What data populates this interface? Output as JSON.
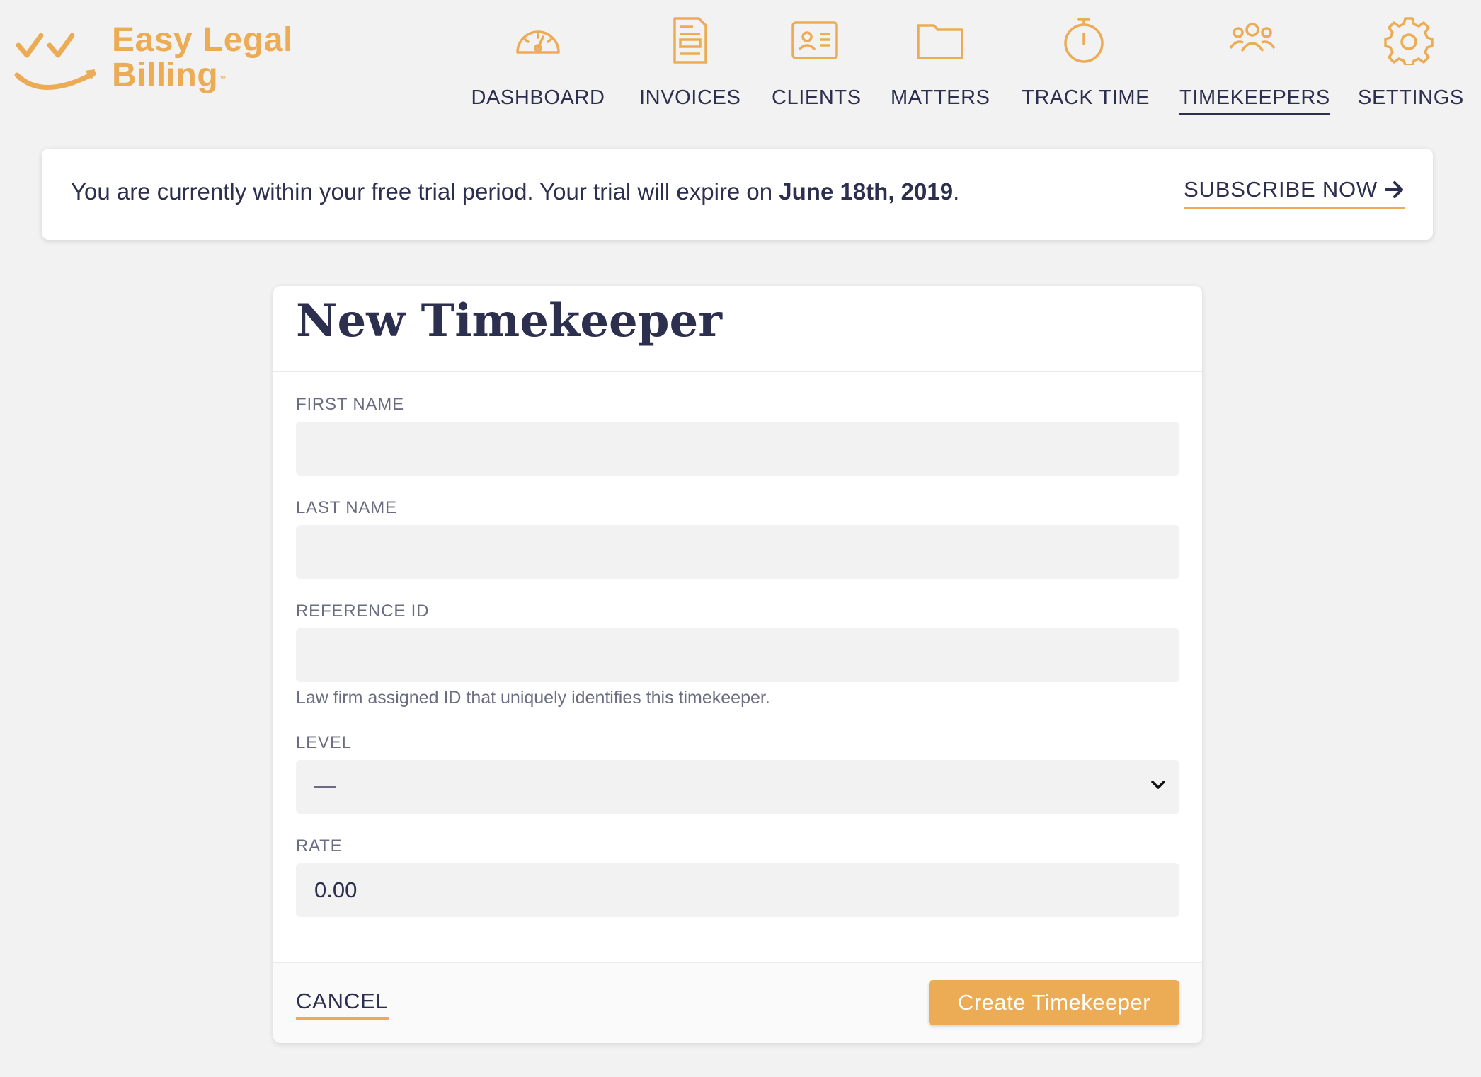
{
  "brand": {
    "line1": "Easy Legal",
    "line2": "Billing",
    "trademark": "™",
    "color": "#ecac55"
  },
  "nav": {
    "items": [
      {
        "label": "DASHBOARD",
        "icon": "gauge-icon"
      },
      {
        "label": "INVOICES",
        "icon": "document-icon"
      },
      {
        "label": "CLIENTS",
        "icon": "contact-card-icon"
      },
      {
        "label": "MATTERS",
        "icon": "folder-icon"
      },
      {
        "label": "TRACK TIME",
        "icon": "stopwatch-icon"
      },
      {
        "label": "TIMEKEEPERS",
        "icon": "people-icon",
        "active": true
      },
      {
        "label": "SETTINGS",
        "icon": "gear-icon"
      }
    ]
  },
  "banner": {
    "text": "You are currently within your free trial period. Your trial will expire on ",
    "date": "June 18th, 2019",
    "suffix": ".",
    "subscribe_label": "SUBSCRIBE NOW"
  },
  "form": {
    "title": "New Timekeeper",
    "first_name": {
      "label": "FIRST NAME",
      "value": ""
    },
    "last_name": {
      "label": "LAST NAME",
      "value": ""
    },
    "reference_id": {
      "label": "REFERENCE ID",
      "value": "",
      "help": "Law firm assigned ID that uniquely identifies this timekeeper."
    },
    "level": {
      "label": "LEVEL",
      "selected": "—"
    },
    "rate": {
      "label": "RATE",
      "value": "0.00"
    },
    "cancel_label": "CANCEL",
    "submit_label": "Create Timekeeper"
  },
  "colors": {
    "accent": "#ecac55",
    "navy": "#2c2f4d",
    "background": "#f2f2f2"
  }
}
